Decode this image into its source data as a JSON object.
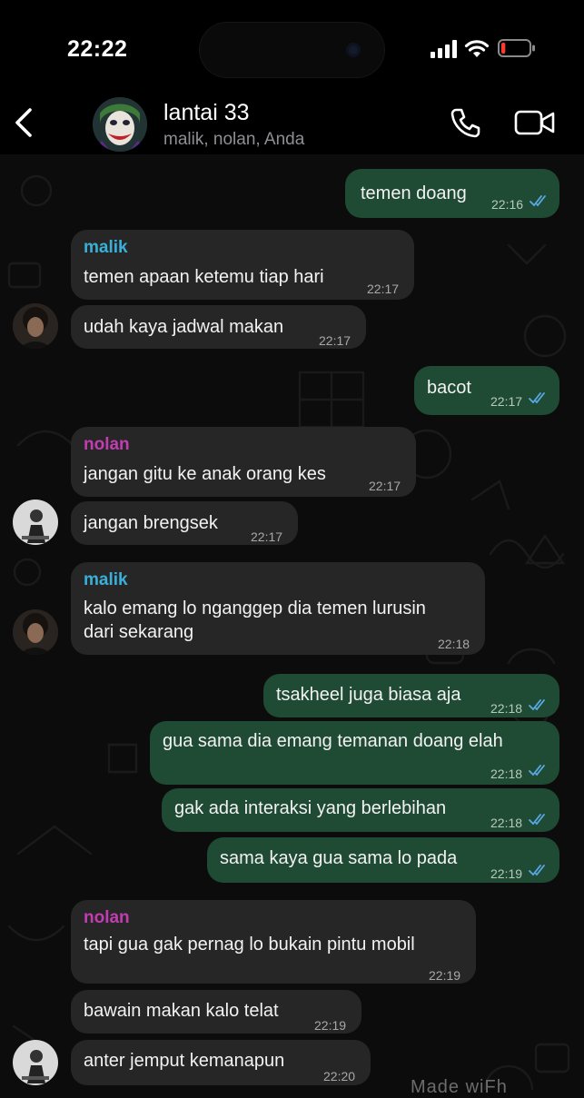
{
  "status_bar": {
    "time": "22:22",
    "battery_level": 0.15,
    "battery_color": "#ff3b30"
  },
  "header": {
    "title": "lantai 33",
    "subtitle": "malik, nolan, Anda",
    "icons": [
      "back-chevron-icon",
      "group-avatar",
      "phone-icon",
      "video-camera-icon"
    ]
  },
  "colors": {
    "incoming_bubble": "#262626",
    "outgoing_bubble": "#1f4a34",
    "sender_malik": "#3ab0d8",
    "sender_nolan": "#c23db2",
    "read_ticks": "#5aa9e6"
  },
  "messages": [
    {
      "dir": "out",
      "text": "temen doang",
      "time": "22:16",
      "read": true
    },
    {
      "dir": "in",
      "sender": "malik",
      "text": "temen apaan ketemu tiap hari",
      "time": "22:17"
    },
    {
      "dir": "in",
      "text": "udah kaya jadwal makan",
      "time": "22:17"
    },
    {
      "dir": "out",
      "text": "bacot",
      "time": "22:17",
      "read": true
    },
    {
      "dir": "in",
      "sender": "nolan",
      "text": "jangan gitu ke anak orang kes",
      "time": "22:17"
    },
    {
      "dir": "in",
      "text": "jangan brengsek",
      "time": "22:17"
    },
    {
      "dir": "in",
      "sender": "malik",
      "text": "kalo emang lo nganggep dia temen lurusin\ndari sekarang",
      "time": "22:18"
    },
    {
      "dir": "out",
      "text": "tsakheel juga biasa aja",
      "time": "22:18",
      "read": true
    },
    {
      "dir": "out",
      "text": "gua sama dia emang temanan doang elah",
      "time": "22:18",
      "read": true
    },
    {
      "dir": "out",
      "text": "gak ada interaksi yang berlebihan",
      "time": "22:18",
      "read": true
    },
    {
      "dir": "out",
      "text": "sama kaya gua sama lo pada",
      "time": "22:19",
      "read": true
    },
    {
      "dir": "in",
      "sender": "nolan",
      "text": "tapi gua gak pernag lo bukain pintu mobil",
      "time": "22:19"
    },
    {
      "dir": "in",
      "text": "bawain makan kalo telat",
      "time": "22:19"
    },
    {
      "dir": "in",
      "text": "anter jemput kemanapun",
      "time": "22:20"
    }
  ],
  "watermark": "Made wiFh"
}
